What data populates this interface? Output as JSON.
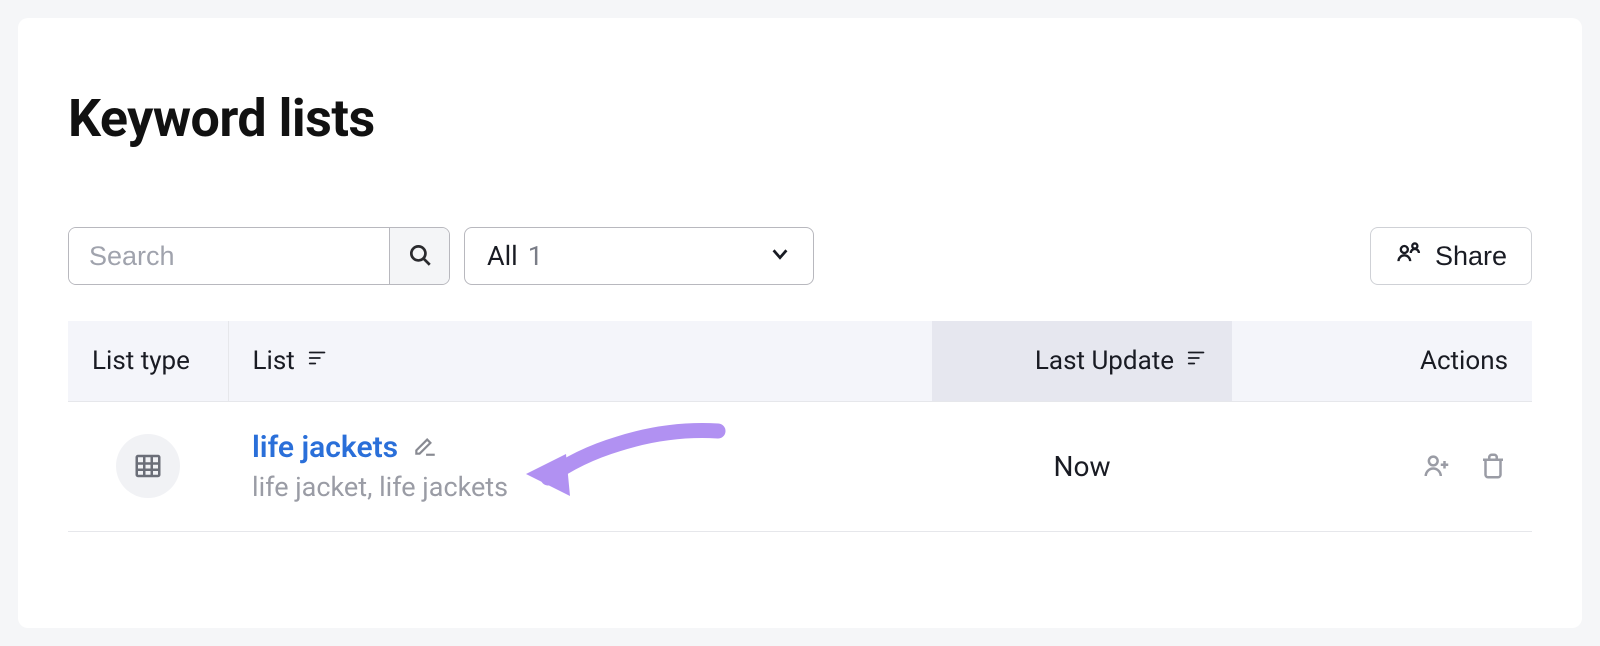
{
  "page": {
    "title": "Keyword lists"
  },
  "toolbar": {
    "search": {
      "placeholder": "Search",
      "value": ""
    },
    "filter": {
      "label": "All",
      "count": "1"
    },
    "share_label": "Share"
  },
  "table": {
    "headers": {
      "list_type": "List type",
      "list": "List",
      "last_update": "Last Update",
      "actions": "Actions"
    },
    "rows": [
      {
        "name": "life jackets",
        "subtitle": "life jacket, life jackets",
        "last_update": "Now"
      }
    ]
  }
}
